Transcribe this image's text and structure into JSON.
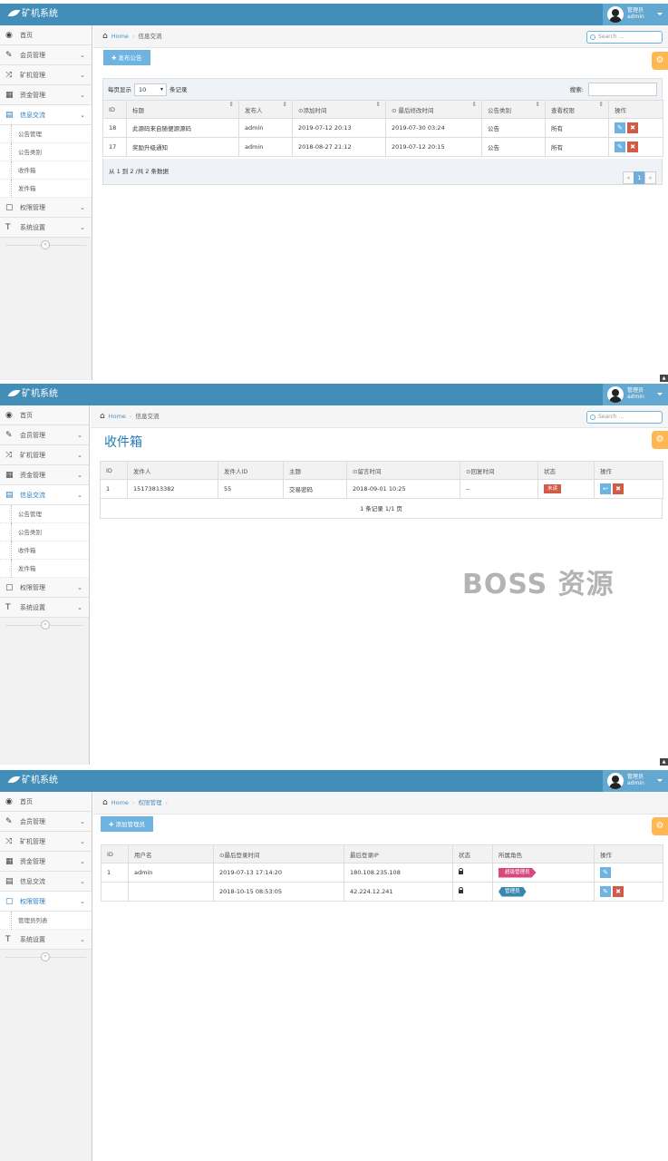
{
  "brand": "矿机系统",
  "user": {
    "role": "管理员",
    "name": "admin"
  },
  "search_placeholder": "Search ...",
  "home": "Home",
  "gear": "⚙",
  "watermark": "BOSS 资源",
  "nav": {
    "home": "首页",
    "member": "会员管理",
    "miner": "矿机管理",
    "funds": "资金管理",
    "info": "信息交流",
    "perm": "权限管理",
    "sys": "系统设置"
  },
  "info_sub": [
    "公告管理",
    "公告类别",
    "收件箱",
    "发件箱"
  ],
  "perm_sub": [
    "管理员列表"
  ],
  "panel1": {
    "crumb": "信息交流",
    "add_button": "发布公告",
    "length_label": "每页显示",
    "length_value": "10",
    "length_suffix": "条记录",
    "search_label": "搜索:",
    "columns": [
      "ID",
      "标题",
      "发布人",
      "⊙添加时间",
      "⊙ 最后修改时间",
      "公告类别",
      "查看权限",
      "操作"
    ],
    "rows": [
      [
        "18",
        "此源码来自随便源源码",
        "admin",
        "2019-07-12 20:13",
        "2019-07-30 03:24",
        "公告",
        "所有"
      ],
      [
        "17",
        "奖励升级通知",
        "admin",
        "2018-08-27 21:12",
        "2019-07-12 20:15",
        "公告",
        "所有"
      ]
    ],
    "info": "从 1 到 2 /共 2 条数据",
    "pager": [
      "«",
      "1",
      "»"
    ]
  },
  "panel2": {
    "crumb": "信息交流",
    "title": "收件箱",
    "columns": [
      "ID",
      "发件人",
      "发件人ID",
      "主题",
      "⊙留言时间",
      "⊙回复时间",
      "状态",
      "操作"
    ],
    "rows": [
      [
        "1",
        "15173813382",
        "55",
        "交易密码",
        "2018-09-01 10:25",
        "--",
        "未读"
      ]
    ],
    "note": "1 条记录 1/1 页"
  },
  "panel3": {
    "crumb": "权限管理",
    "add_button": "添加管理员",
    "columns": [
      "ID",
      "用户名",
      "⊙最后登录时间",
      "最后登录IP",
      "状态",
      "所属角色",
      "操作"
    ],
    "rows": [
      [
        "1",
        "admin",
        "2019-07-13 17:14:20",
        "180.108.235.108",
        "",
        "超级管理员"
      ],
      [
        "",
        "",
        "2018-10-15 08:53:05",
        "42.224.12.241",
        "",
        "管理员"
      ]
    ]
  },
  "colors": {
    "topbar": "#438eb9",
    "accent": "#6fb3e0",
    "danger": "#d15b47",
    "pink": "#d6487e",
    "teal": "#3a87ad",
    "gear": "#ffb752"
  }
}
